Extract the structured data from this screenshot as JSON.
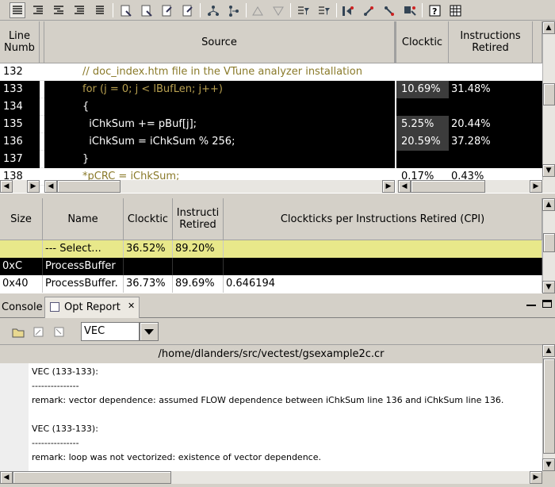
{
  "toolbar": {
    "icons": [
      "list-view-icon",
      "indent-left-icon",
      "indent-right-icon",
      "outdent-icon",
      "align-icon",
      "page-icon-1",
      "page-icon-2",
      "page-icon-3",
      "page-icon-4",
      "tree-icon-1",
      "tree-icon-2",
      "up-triangle-icon",
      "down-triangle-icon",
      "filter-icon-1",
      "filter-icon-2",
      "nav-icon-1",
      "nav-icon-2",
      "nav-icon-3",
      "nav-icon-4",
      "help-icon",
      "grid-icon"
    ]
  },
  "source": {
    "headers": {
      "line": "Line\nNumb",
      "source": "Source",
      "clockticks": "Clocktic",
      "instructions": "Instructions\nRetired"
    },
    "rows": [
      {
        "line": "132",
        "code": "// doc_index.htm file in the VTune analyzer installation",
        "clockticks": "",
        "instructions": "",
        "style": "normal"
      },
      {
        "line": "133",
        "code": "for (j = 0; j < lBufLen; j++)",
        "clockticks": "10.69%",
        "instructions": "31.48%",
        "style": "hot"
      },
      {
        "line": "134",
        "code": "{",
        "clockticks": "",
        "instructions": "",
        "style": "hot"
      },
      {
        "line": "135",
        "code": "  iChkSum += pBuf[j];",
        "clockticks": "5.25%",
        "instructions": "20.44%",
        "style": "hot"
      },
      {
        "line": "136",
        "code": "  iChkSum = iChkSum % 256;",
        "clockticks": "20.59%",
        "instructions": "37.28%",
        "style": "hot"
      },
      {
        "line": "137",
        "code": "}",
        "clockticks": "",
        "instructions": "",
        "style": "hot"
      },
      {
        "line": "138",
        "code": "*pCRC = iChkSum;",
        "clockticks": "0.17%",
        "instructions": "0.43%",
        "style": "normal"
      }
    ]
  },
  "functions": {
    "headers": {
      "size": "Size",
      "name": "Name",
      "clockticks": "Clocktic",
      "instructions": "Instructi\nRetired",
      "cpi": "Clockticks per Instructions Retired (CPI)"
    },
    "rows": [
      {
        "size": "",
        "name": "--- Select...",
        "clockticks": "36.52%",
        "instructions": "89.20%",
        "cpi": "",
        "style": "yellow"
      },
      {
        "size": "0xC",
        "name": "ProcessBuffer",
        "clockticks": "",
        "instructions": "",
        "cpi": "",
        "style": "black"
      },
      {
        "size": "0x40",
        "name": "ProcessBuffer.",
        "clockticks": "36.73%",
        "instructions": "89.69%",
        "cpi": "0.646194",
        "style": "white"
      }
    ]
  },
  "tabs": {
    "console": "Console",
    "opt_report": "Opt Report",
    "close": "✕"
  },
  "report_toolbar": {
    "select_value": "VEC"
  },
  "report": {
    "path": "/home/dlanders/src/vectest/gsexample2c.cr",
    "lines": [
      "VEC (133-133):",
      "---------------",
      "remark: vector dependence: assumed FLOW dependence between iChkSum line 136 and iChkSum line 136.",
      "",
      "VEC (133-133):",
      "---------------",
      "remark: loop was not vectorized: existence of vector dependence."
    ]
  },
  "colors": {
    "hot_row": "#000000",
    "selected_row": "#e8e88a",
    "code_comment": "#8a7a2a",
    "code_keyword": "#b8a050"
  }
}
